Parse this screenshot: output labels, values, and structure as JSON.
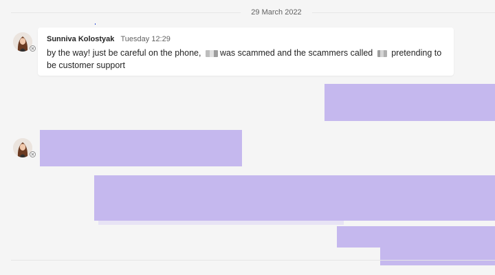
{
  "chat": {
    "date_separator": "29 March 2022",
    "message": {
      "sender": "Sunniva Kolostyak",
      "time": "Tuesday 12:29",
      "text_part1": "by the way! just be careful on the phone,",
      "text_part2": "was scammed and the scammers called",
      "text_part3": "pretending to be customer support"
    }
  },
  "icons": {
    "avatar": "avatar-icon",
    "presence": "presence-offline-icon",
    "redacted": "redacted-image-icon"
  },
  "colors": {
    "background": "#f5f5f5",
    "card": "#ffffff",
    "redaction_purple": "#c5b8ee",
    "presence": "#8a8a8a"
  }
}
